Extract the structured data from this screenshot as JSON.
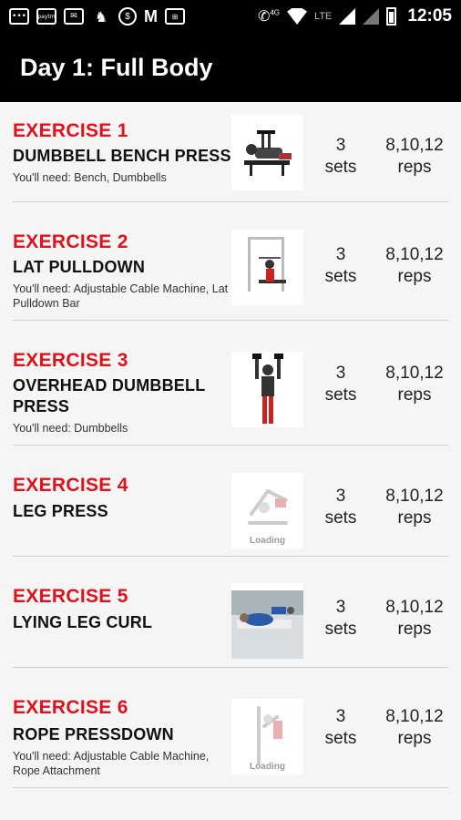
{
  "status_bar": {
    "icons": [
      "message-icon",
      "paytm-icon",
      "gmail-icon",
      "notification-icon",
      "app-icon",
      "myntra-icon",
      "store-icon",
      "call-4g-icon",
      "wifi-icon",
      "signal-icon",
      "battery-icon"
    ],
    "app_badge": "paytm",
    "lte": "LTE",
    "time": "12:05"
  },
  "header": {
    "title": "Day 1: Full Body"
  },
  "exercises": [
    {
      "label": "EXERCISE 1",
      "name": "DUMBBELL BENCH PRESS",
      "need": "You'll need: Bench, Dumbbells",
      "sets": "3",
      "sets_unit": "sets",
      "reps": "8,10,12",
      "reps_unit": "reps",
      "thumb": "bench-press-image"
    },
    {
      "label": "EXERCISE 2",
      "name": "LAT PULLDOWN",
      "need": "You'll need: Adjustable Cable Machine, Lat Pulldown Bar",
      "sets": "3",
      "sets_unit": "sets",
      "reps": "8,10,12",
      "reps_unit": "reps",
      "thumb": "lat-pulldown-image"
    },
    {
      "label": "EXERCISE 3",
      "name": "OVERHEAD DUMBBELL PRESS",
      "need": "You'll need: Dumbbells",
      "sets": "3",
      "sets_unit": "sets",
      "reps": "8,10,12",
      "reps_unit": "reps",
      "thumb": "overhead-press-image"
    },
    {
      "label": "EXERCISE 4",
      "name": "LEG PRESS",
      "need": "",
      "sets": "3",
      "sets_unit": "sets",
      "reps": "8,10,12",
      "reps_unit": "reps",
      "thumb": "loading-image",
      "loading": "Loading"
    },
    {
      "label": "EXERCISE 5",
      "name": "LYING LEG CURL",
      "need": "",
      "sets": "3",
      "sets_unit": "sets",
      "reps": "8,10,12",
      "reps_unit": "reps",
      "thumb": "leg-curl-image"
    },
    {
      "label": "EXERCISE 6",
      "name": "ROPE PRESSDOWN",
      "need": "You'll need: Adjustable Cable Machine, Rope Attachment",
      "sets": "3",
      "sets_unit": "sets",
      "reps": "8,10,12",
      "reps_unit": "reps",
      "thumb": "loading-image",
      "loading": "Loading"
    }
  ]
}
